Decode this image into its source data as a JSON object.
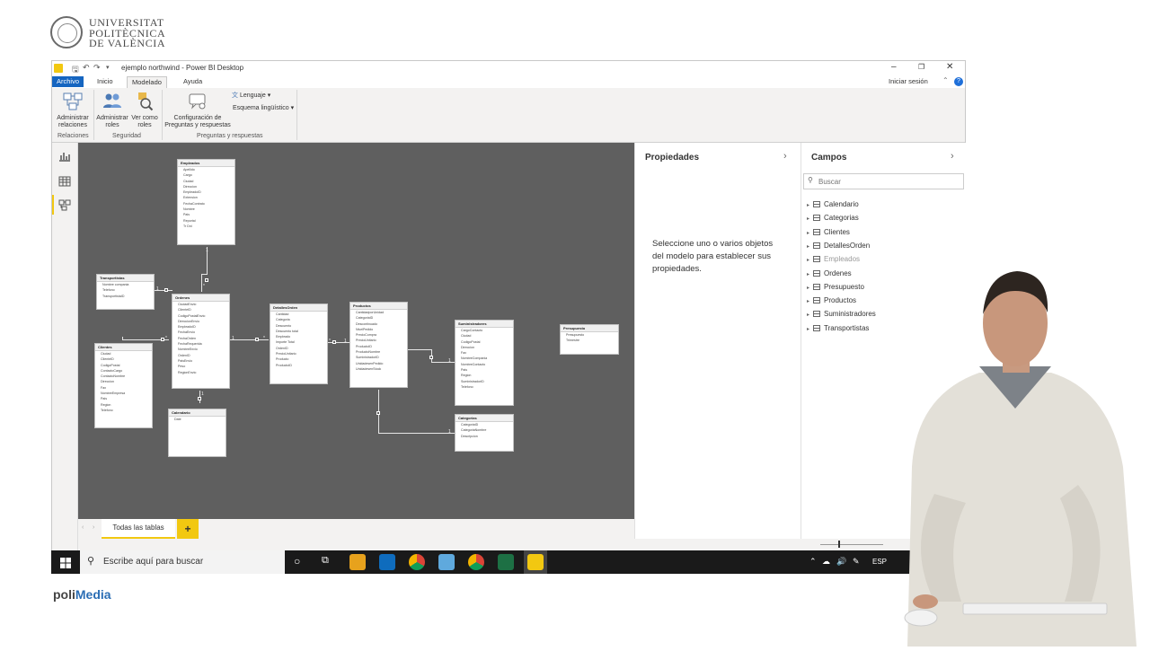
{
  "logo": {
    "line1": "UNIVERSITAT",
    "line2": "POLITÈCNICA",
    "line3": "DE VALÈNCIA"
  },
  "window": {
    "title": "ejemplo northwind - Power BI Desktop",
    "signin": "Iniciar sesión"
  },
  "tabs": [
    "Archivo",
    "Inicio",
    "Modelado",
    "Ayuda"
  ],
  "ribbon": {
    "manage_relations": "Administrar relaciones",
    "manage_roles": "Administrar roles",
    "view_as": "Ver como roles",
    "qa_config": "Configuración de Preguntas y respuestas",
    "language": "Lenguaje",
    "linguistic": "Esquema lingüístico",
    "groups": {
      "relations": "Relaciones",
      "security": "Seguridad",
      "qa": "Preguntas y respuestas"
    }
  },
  "bottom_tab": {
    "label": "Todas las tablas",
    "add": "+"
  },
  "properties": {
    "title": "Propiedades",
    "message": "Seleccione uno o varios objetos del modelo para establecer sus propiedades."
  },
  "fields": {
    "title": "Campos",
    "search_placeholder": "Buscar",
    "items": [
      "Calendario",
      "Categorias",
      "Clientes",
      "DetallesOrden",
      "Empleados",
      "Ordenes",
      "Presupuesto",
      "Productos",
      "Suministradores",
      "Transportistas"
    ]
  },
  "taskbar": {
    "search": "Escribe aquí para buscar",
    "lang": "ESP"
  },
  "footer": {
    "brand_a": "poli",
    "brand_b": "Media"
  },
  "model": {
    "empleados": {
      "title": "Empleados",
      "fields": [
        "Apellido",
        "Cargo",
        "Ciudad",
        "Direccion",
        "EmpleadoID",
        "Extension",
        "FechaContrato",
        "Nombre",
        "Pais",
        "Reportal",
        "Tr Dni"
      ]
    },
    "transportistas": {
      "title": "Transportistas",
      "fields": [
        "Nombre compania",
        "Telefono",
        "TransportistaID"
      ]
    },
    "ordenes": {
      "title": "Ordenes",
      "fields": [
        "CiudadEnvio",
        "ClienteID",
        "CodigoPostalEnvio",
        "DireccionEnvio",
        "EmpleadoID",
        "FechaEnvio",
        "FechaOrden",
        "FechaRequerida",
        "NombreEnvio",
        "OrdenID",
        "PaisEnvio",
        "Peso",
        "RegionEnvio"
      ]
    },
    "clientes": {
      "title": "Clientes",
      "fields": [
        "Ciudad",
        "ClienteID",
        "CodigoPostal",
        "ContactoCargo",
        "ContactoNombre",
        "Direccion",
        "Fax",
        "NombreEmpresa",
        "Pais",
        "Region",
        "Telefono"
      ]
    },
    "calendario": {
      "title": "Calendario",
      "fields": [
        "Date"
      ]
    },
    "detalles": {
      "title": "DetallesOrden",
      "fields": [
        "Cantidad",
        "Categoria",
        "Descuento",
        "Descuento total",
        "Empleado",
        "Importe Total",
        "OrdenID",
        "PrecioUnitario",
        "Producto",
        "ProductoID"
      ]
    },
    "productos": {
      "title": "Productos",
      "fields": [
        "CantidadporUnidad",
        "CategoriaID",
        "Descontinuado",
        "NivelPedido",
        "PrecioCompra",
        "PrecioUnitario",
        "ProductoID",
        "ProductoNombre",
        "SuministradorID",
        "UnidadesenPedido",
        "UnidadesenStock"
      ]
    },
    "suministradores": {
      "title": "Suministradores",
      "fields": [
        "CargoContacto",
        "Ciudad",
        "CodigoPostal",
        "Direccion",
        "Fax",
        "NombreCompania",
        "NombreContacto",
        "Pais",
        "Region",
        "SuministradorID",
        "Telefono"
      ]
    },
    "categorias": {
      "title": "Categorias",
      "fields": [
        "CategoriaID",
        "CategoriaNombre",
        "Descripcion"
      ]
    },
    "presupuesto": {
      "title": "Presupuesto",
      "fields": [
        "Presupuesto",
        "Trimestre"
      ]
    },
    "card_one": "1",
    "card_many": "*"
  }
}
